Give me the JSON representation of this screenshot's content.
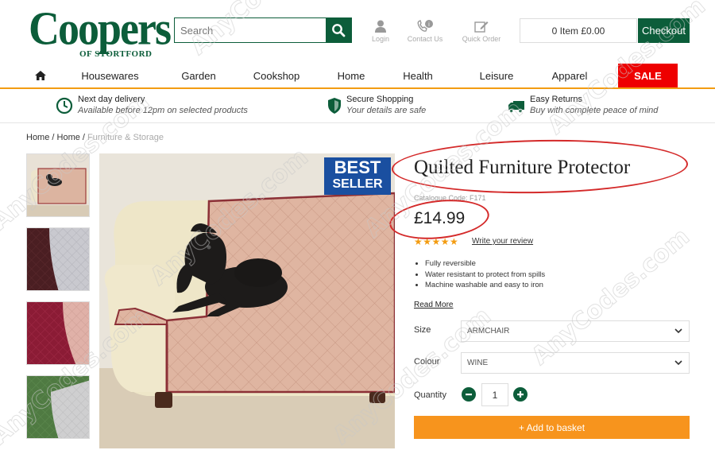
{
  "header": {
    "logo_main": "Coopers",
    "logo_sub": "OF STORTFORD",
    "search_placeholder": "Search",
    "tools": {
      "login": "Login",
      "contact": "Contact Us",
      "quick_order": "Quick Order"
    },
    "cart_summary": "0 Item £0.00",
    "checkout_label": "Checkout"
  },
  "nav": {
    "items": [
      "Housewares",
      "Garden",
      "Cookshop",
      "Home",
      "Health",
      "Leisure",
      "Apparel"
    ],
    "sale_label": "SALE"
  },
  "usp": [
    {
      "title": "Next day delivery",
      "subtitle": "Available before 12pm on selected products",
      "icon": "clock-icon"
    },
    {
      "title": "Secure Shopping",
      "subtitle": "Your details are safe",
      "icon": "shield-icon"
    },
    {
      "title": "Easy Returns",
      "subtitle": "Buy with complete peace of mind",
      "icon": "truck-icon"
    }
  ],
  "breadcrumb": {
    "items": [
      "Home",
      "Home"
    ],
    "current": "Furniture & Storage",
    "separator": " / "
  },
  "gallery": {
    "badge_line1": "BEST",
    "badge_line2": "SELLER"
  },
  "product": {
    "title": "Quilted Furniture Protector",
    "catalogue_code": "Catalogue Code: F171",
    "price": "£14.99",
    "stars": "★★★★★",
    "rating": 4.5,
    "write_review": "Write your review",
    "features": [
      "Fully reversible",
      "Water resistant to protect from spills",
      "Machine washable and easy to iron"
    ],
    "read_more": "Read More",
    "size_label": "Size",
    "size_value": "ARMCHAIR",
    "colour_label": "Colour",
    "colour_value": "WINE",
    "quantity_label": "Quantity",
    "quantity_value": "1",
    "add_to_basket": "+ Add to basket"
  },
  "watermark": "AnyCodes.com",
  "colors": {
    "brand_green": "#0c5d3a",
    "accent_orange": "#f7941d",
    "sale_red": "#ee0000",
    "badge_blue": "#1a4fa0",
    "annotation_red": "#d42a2a"
  }
}
